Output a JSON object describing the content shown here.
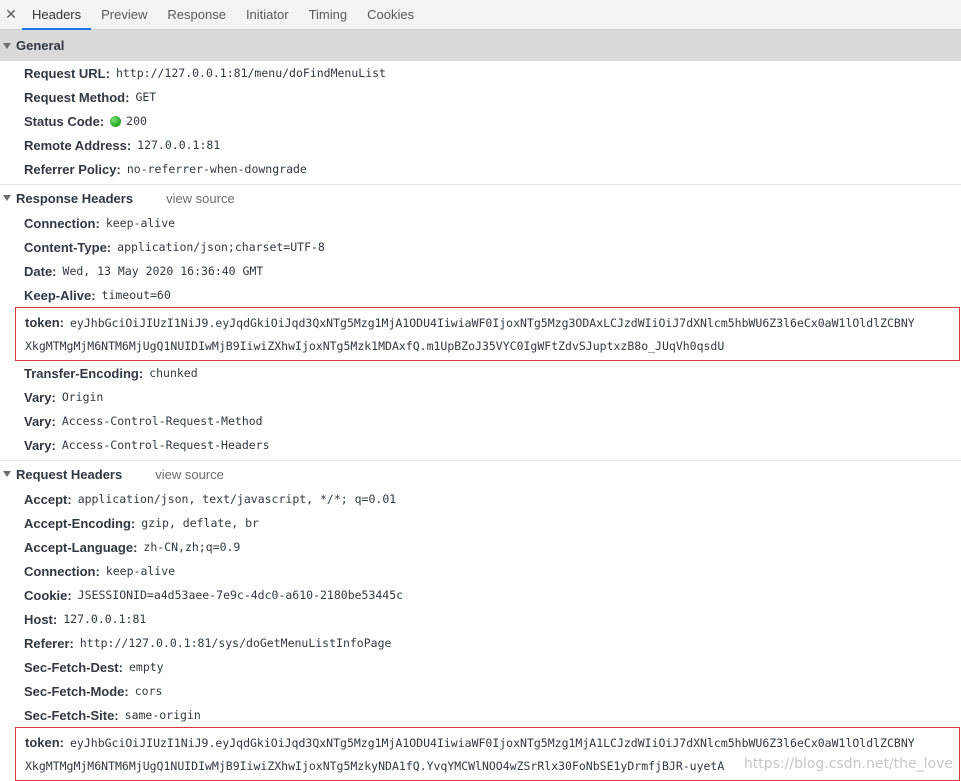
{
  "tabs": {
    "close": "✕",
    "items": [
      "Headers",
      "Preview",
      "Response",
      "Initiator",
      "Timing",
      "Cookies"
    ]
  },
  "general": {
    "title": "General",
    "request_url_key": "Request URL:",
    "request_url": "http://127.0.0.1:81/menu/doFindMenuList",
    "method_key": "Request Method:",
    "method": "GET",
    "status_key": "Status Code:",
    "status": "200",
    "remote_key": "Remote Address:",
    "remote": "127.0.0.1:81",
    "referrer_key": "Referrer Policy:",
    "referrer": "no-referrer-when-downgrade"
  },
  "response": {
    "title": "Response Headers",
    "view_source": "view source",
    "headers": [
      {
        "k": "Connection:",
        "v": "keep-alive"
      },
      {
        "k": "Content-Type:",
        "v": "application/json;charset=UTF-8"
      },
      {
        "k": "Date:",
        "v": "Wed, 13 May 2020 16:36:40 GMT"
      },
      {
        "k": "Keep-Alive:",
        "v": "timeout=60"
      }
    ],
    "token_key": "token:",
    "token_line1": "eyJhbGciOiJIUzI1NiJ9.eyJqdGkiOiJqd3QxNTg5Mzg1MjA1ODU4IiwiaWF0IjoxNTg5Mzg3ODAxLCJzdWIiOiJ7dXNlcm5hbWU6Z3l6eCx0aW1lOldlZCBNY",
    "token_line2": "XkgMTMgMjM6NTM6MjUgQ1NUIDIwMjB9IiwiZXhwIjoxNTg5Mzk1MDAxfQ.m1UpBZoJ35VYC0IgWFtZdvSJuptxzB8o_JUqVh0qsdU",
    "headers_after": [
      {
        "k": "Transfer-Encoding:",
        "v": "chunked"
      },
      {
        "k": "Vary:",
        "v": "Origin"
      },
      {
        "k": "Vary:",
        "v": "Access-Control-Request-Method"
      },
      {
        "k": "Vary:",
        "v": "Access-Control-Request-Headers"
      }
    ]
  },
  "request": {
    "title": "Request Headers",
    "view_source": "view source",
    "headers": [
      {
        "k": "Accept:",
        "v": "application/json, text/javascript, */*; q=0.01"
      },
      {
        "k": "Accept-Encoding:",
        "v": "gzip, deflate, br"
      },
      {
        "k": "Accept-Language:",
        "v": "zh-CN,zh;q=0.9"
      },
      {
        "k": "Connection:",
        "v": "keep-alive"
      },
      {
        "k": "Cookie:",
        "v": "JSESSIONID=a4d53aee-7e9c-4dc0-a610-2180be53445c"
      },
      {
        "k": "Host:",
        "v": "127.0.0.1:81"
      },
      {
        "k": "Referer:",
        "v": "http://127.0.0.1:81/sys/doGetMenuListInfoPage"
      },
      {
        "k": "Sec-Fetch-Dest:",
        "v": "empty"
      },
      {
        "k": "Sec-Fetch-Mode:",
        "v": "cors"
      },
      {
        "k": "Sec-Fetch-Site:",
        "v": "same-origin"
      }
    ],
    "token_key": "token:",
    "token_line1": "eyJhbGciOiJIUzI1NiJ9.eyJqdGkiOiJqd3QxNTg5Mzg1MjA1ODU4IiwiaWF0IjoxNTg5Mzg1MjA1LCJzdWIiOiJ7dXNlcm5hbWU6Z3l6eCx0aW1lOldlZCBNY",
    "token_line2": "XkgMTMgMjM6NTM6MjUgQ1NUIDIwMjB9IiwiZXhwIjoxNTg5MzkyNDA1fQ.YvqYMCWlNOO4wZSrRlx30FoNbSE1yDrmfjBJR-uyetA"
  },
  "watermark": "https://blog.csdn.net/the_love",
  "colors": {
    "accent": "#1a73e8",
    "status_ok": "#1ea51e",
    "highlight_box": "#d33c3c"
  }
}
